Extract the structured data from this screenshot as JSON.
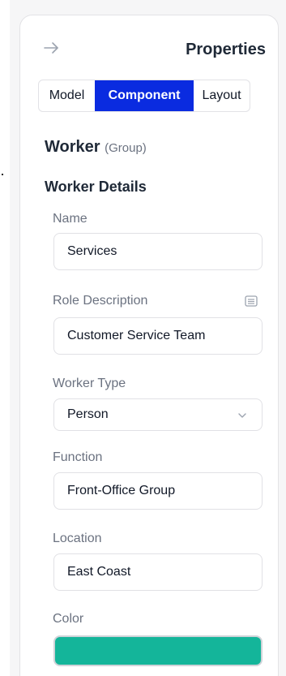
{
  "panel": {
    "title": "Properties",
    "collapse_icon": "arrow-right-icon"
  },
  "tabs": [
    {
      "label": "Model",
      "active": false
    },
    {
      "label": "Component",
      "active": true
    },
    {
      "label": "Layout",
      "active": false
    }
  ],
  "component": {
    "name": "Worker",
    "kind": "(Group)"
  },
  "section": {
    "title": "Worker Details"
  },
  "fields": {
    "name": {
      "label": "Name",
      "value": "Services"
    },
    "role_description": {
      "label": "Role Description",
      "value": "Customer Service Team",
      "icon": "notes-icon"
    },
    "worker_type": {
      "label": "Worker Type",
      "value": "Person",
      "icon": "chevron-down-icon"
    },
    "function": {
      "label": "Function",
      "value": "Front-Office Group"
    },
    "location": {
      "label": "Location",
      "value": "East Coast"
    },
    "color": {
      "label": "Color",
      "value": "#14b59a"
    }
  },
  "colors": {
    "accent": "#0a2be0",
    "swatch": "#14b59a"
  }
}
